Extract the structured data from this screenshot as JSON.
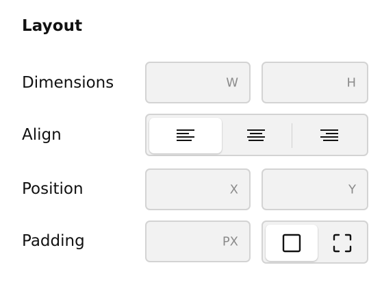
{
  "section": {
    "title": "Layout"
  },
  "rows": {
    "dimensions": {
      "label": "Dimensions",
      "width_unit": "W",
      "height_unit": "H"
    },
    "align": {
      "label": "Align",
      "options": [
        "left",
        "center",
        "right"
      ],
      "selected": "left"
    },
    "position": {
      "label": "Position",
      "x_unit": "X",
      "y_unit": "Y"
    },
    "padding": {
      "label": "Padding",
      "unit": "PX",
      "modes": [
        "uniform",
        "individual"
      ],
      "selected": "uniform"
    }
  },
  "icons": {
    "align_left": "align-left-icon",
    "align_center": "align-center-icon",
    "align_right": "align-right-icon",
    "padding_uniform": "square-icon",
    "padding_individual": "corners-icon"
  },
  "colors": {
    "field_bg": "#f2f2f2",
    "field_border": "#d3d3d3",
    "unit_text": "#8b8b8b",
    "text": "#111111",
    "active_segment": "#ffffff"
  }
}
